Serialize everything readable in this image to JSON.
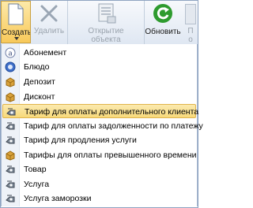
{
  "ribbon": {
    "create_label": "Создать",
    "delete_label": "Удалить",
    "open_label": "Открытие объекта",
    "refresh_label": "Обновить",
    "next_label": "П о"
  },
  "menu": {
    "items": [
      {
        "label": "Абонемент",
        "icon": "subscription-icon"
      },
      {
        "label": "Блюдо",
        "icon": "dish-icon"
      },
      {
        "label": "Депозит",
        "icon": "box-icon"
      },
      {
        "label": "Дисконт",
        "icon": "box-icon"
      },
      {
        "label": "Тариф для оплаты дополнительного клиента",
        "icon": "tariff-icon",
        "highlighted": true
      },
      {
        "label": "Тариф для оплаты задолженности по платежу",
        "icon": "tariff-icon"
      },
      {
        "label": "Тариф для продления услуги",
        "icon": "tariff-icon"
      },
      {
        "label": "Тарифы для оплаты превышенного времени",
        "icon": "box-icon"
      },
      {
        "label": "Товар",
        "icon": "tariff-icon"
      },
      {
        "label": "Услуга",
        "icon": "tariff-icon"
      },
      {
        "label": "Услуга заморозки",
        "icon": "tariff-icon"
      }
    ]
  },
  "colors": {
    "accent": "#f8c95a",
    "highlight": "#fbeaaf",
    "refresh_green": "#2e9b2e"
  }
}
